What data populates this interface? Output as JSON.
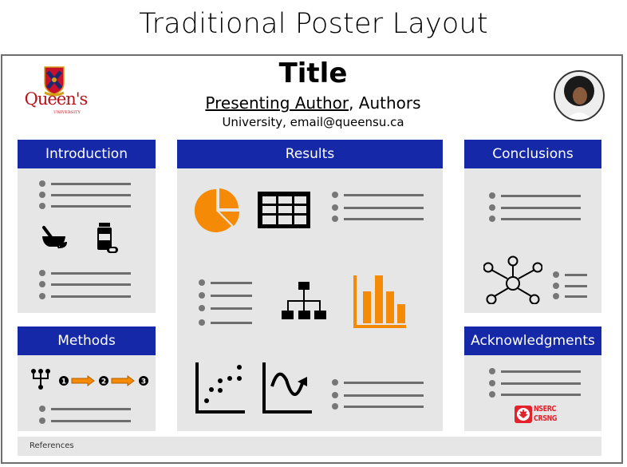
{
  "page_title": "Traditional Poster Layout",
  "poster": {
    "title": "Title",
    "presenting_author": "Presenting Author",
    "other_authors": ", Authors",
    "affiliation": "University, email@queensu.ca",
    "logo": {
      "name": "Queen's",
      "sub": "UNIVERSITY",
      "icon": "queens-crest-icon"
    },
    "photo": {
      "icon": "author-photo"
    }
  },
  "sections": {
    "introduction": {
      "label": "Introduction",
      "icons": [
        "mortar-pestle-icon",
        "medicine-bottle-icon"
      ]
    },
    "methods": {
      "label": "Methods",
      "steps": [
        "1",
        "2",
        "3"
      ],
      "icons": [
        "hierarchy-tree-icon",
        "process-arrow-icon"
      ]
    },
    "results": {
      "label": "Results",
      "icons": [
        "pie-chart-icon",
        "table-icon",
        "org-chart-icon",
        "bar-chart-icon",
        "scatter-plot-icon",
        "line-chart-icon"
      ]
    },
    "conclusions": {
      "label": "Conclusions",
      "icons": [
        "network-icon"
      ]
    },
    "acknowledgments": {
      "label": "Acknowledgments",
      "sponsor": {
        "line1": "NSERC",
        "line2": "CRSNG",
        "icon": "maple-leaf-icon"
      }
    }
  },
  "references": {
    "label": "References"
  },
  "colors": {
    "header": "#1428a8",
    "panel": "#e6e6e6",
    "accent": "#f58a07",
    "bullet": "#6e6e6e",
    "border": "#6e6e6e",
    "logo_red": "#b5121b"
  }
}
